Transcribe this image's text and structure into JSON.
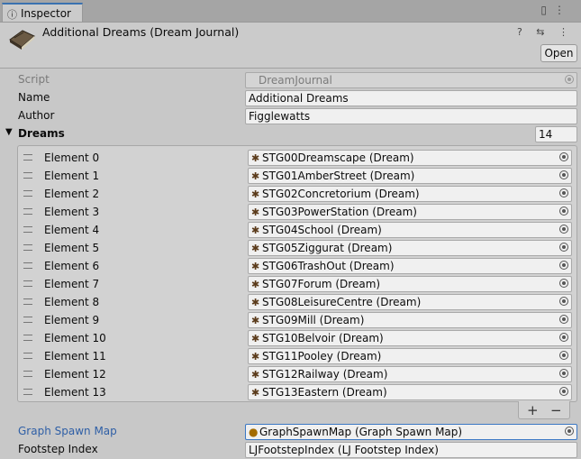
{
  "tab": {
    "icon": "info-icon",
    "glyph": "ⓘ",
    "label": "Inspector"
  },
  "tab_icons": {
    "lock": "🔒",
    "menu": "⋮"
  },
  "header": {
    "title": "Additional Dreams (Dream Journal)",
    "buttons_text": "? ⇆ ⋮",
    "open_label": "Open"
  },
  "fields": {
    "script_label": "Script",
    "script_value": "DreamJournal",
    "name_label": "Name",
    "name_value": "Additional Dreams",
    "author_label": "Author",
    "author_value": "Figglewatts"
  },
  "dreams": {
    "label": "Dreams",
    "foldout_glyph": "▼",
    "count": "14",
    "elements": [
      {
        "label": "Element 0",
        "value": "STG00Dreamscape (Dream)"
      },
      {
        "label": "Element 1",
        "value": "STG01AmberStreet (Dream)"
      },
      {
        "label": "Element 2",
        "value": "STG02Concretorium (Dream)"
      },
      {
        "label": "Element 3",
        "value": "STG03PowerStation (Dream)"
      },
      {
        "label": "Element 4",
        "value": "STG04School (Dream)"
      },
      {
        "label": "Element 5",
        "value": "STG05Ziggurat (Dream)"
      },
      {
        "label": "Element 6",
        "value": "STG06TrashOut (Dream)"
      },
      {
        "label": "Element 7",
        "value": "STG07Forum (Dream)"
      },
      {
        "label": "Element 8",
        "value": "STG08LeisureCentre (Dream)"
      },
      {
        "label": "Element 9",
        "value": "STG09Mill (Dream)"
      },
      {
        "label": "Element 10",
        "value": "STG10Belvoir (Dream)"
      },
      {
        "label": "Element 11",
        "value": "STG11Pooley (Dream)"
      },
      {
        "label": "Element 12",
        "value": "STG12Railway (Dream)"
      },
      {
        "label": "Element 13",
        "value": "STG13Eastern (Dream)"
      }
    ],
    "plus": "+",
    "minus": "−"
  },
  "graph_spawn_map": {
    "label": "Graph Spawn Map",
    "value": "GraphSpawnMap (Graph Spawn Map)"
  },
  "footstep_index": {
    "label": "Footstep Index",
    "value": "LJFootstepIndex (LJ Footstep Index)"
  },
  "colors": {
    "accent": "#3b78c4",
    "link_label": "#2f5fa6",
    "panel": "#c8c8c8"
  }
}
